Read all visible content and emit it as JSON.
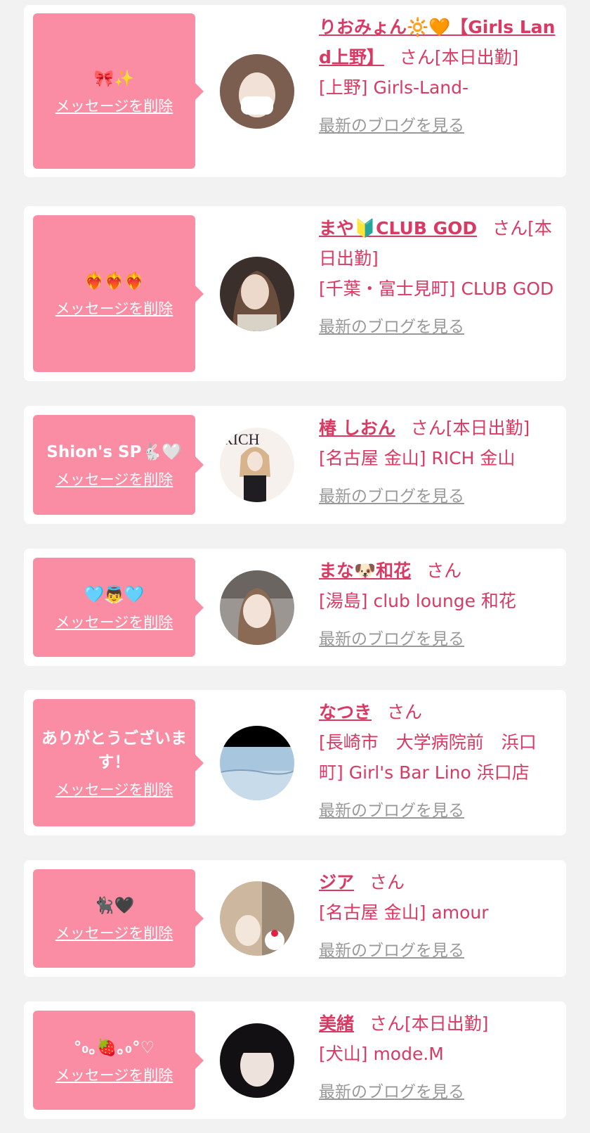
{
  "labels": {
    "delete": "メッセージを削除",
    "san": "さん",
    "blog": "最新のブログを見る"
  },
  "entries": [
    {
      "message": "🎀✨",
      "name": "りおみょん🔆🧡【Girls Land上野】",
      "status": "[本日出勤]",
      "location": "[上野] Girls-Land-",
      "avatar_icon": "avatar-photo-icon",
      "avatar_colors": [
        "#e9d4c6",
        "#6b5044"
      ]
    },
    {
      "message": "❤️‍🔥❤️‍🔥❤️‍🔥",
      "name": "まや🔰CLUB GOD",
      "status": "[本日出勤]",
      "location": "[千葉・富士見町] CLUB GOD",
      "avatar_icon": "avatar-photo-icon",
      "avatar_colors": [
        "#cfc3b4",
        "#3b2e28"
      ]
    },
    {
      "message": "Shion's SP🐇🤍",
      "name": "椿 しおん",
      "status": "[本日出勤]",
      "location": "[名古屋 金山] RICH 金山",
      "avatar_icon": "avatar-magazine-icon",
      "avatar_colors": [
        "#f7f1ee",
        "#2a2730"
      ]
    },
    {
      "message": "🩵👼🩵",
      "name": "まな🐶和花",
      "status": "",
      "location": "[湯島] club lounge 和花",
      "avatar_icon": "avatar-photo-icon",
      "avatar_colors": [
        "#c9c3bf",
        "#4d4845"
      ]
    },
    {
      "message": "ありがとうございます！",
      "name": "なつき",
      "status": "",
      "location": "[長崎市　大学病院前　浜口町] Girl's Bar Lino 浜口店",
      "avatar_icon": "avatar-sea-icon",
      "avatar_colors": [
        "#aac6de",
        "#000000"
      ]
    },
    {
      "message": "🐈‍⬛🖤",
      "name": "ジア",
      "status": "",
      "location": "[名古屋 金山] amour",
      "avatar_icon": "avatar-photo-icon",
      "avatar_colors": [
        "#dccbb5",
        "#5f4d3d"
      ]
    },
    {
      "message": "°₀｡🍓｡₀°♡",
      "name": "美緒",
      "status": "[本日出勤]",
      "location": "[犬山] mode.M",
      "avatar_icon": "avatar-photo-icon",
      "avatar_colors": [
        "#e5dcd6",
        "#121013"
      ]
    }
  ]
}
